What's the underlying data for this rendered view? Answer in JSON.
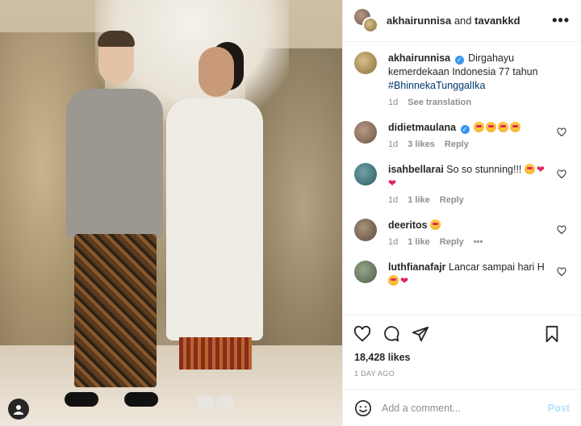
{
  "header": {
    "user1": "akhairunnisa",
    "and": "and",
    "user2": "tavankkd",
    "more": "•••"
  },
  "caption": {
    "username": "akhairunnisa",
    "text": "Dirgahayu kemerdekaan Indonesia 77 tahun",
    "hashtag": "#BhinnekaTunggalIka",
    "age": "1d",
    "translate": "See translation"
  },
  "comments": [
    {
      "username": "didietmaulana",
      "verified": true,
      "age": "1d",
      "likes": "3 likes",
      "reply": "Reply"
    },
    {
      "username": "isahbellarai",
      "text": "So so stunning!!!",
      "age": "1d",
      "likes": "1 like",
      "reply": "Reply"
    },
    {
      "username": "deeritos",
      "age": "1d",
      "likes": "1 like",
      "reply": "Reply",
      "more": "•••"
    },
    {
      "username": "luthfianafajr",
      "text": "Lancar sampai hari H"
    }
  ],
  "engagement": {
    "likes": "18,428 likes",
    "date": "1 DAY AGO"
  },
  "composer": {
    "placeholder": "Add a comment...",
    "post": "Post"
  },
  "colors": {
    "link": "#00376b",
    "verified": "#3897f0",
    "post_disabled": "#b2dffc",
    "heart": "#e0245e"
  },
  "icons": [
    "more-icon",
    "verified-icon",
    "heart-icon",
    "comment-icon",
    "share-icon",
    "bookmark-icon",
    "smile-icon",
    "user-tag-icon"
  ]
}
